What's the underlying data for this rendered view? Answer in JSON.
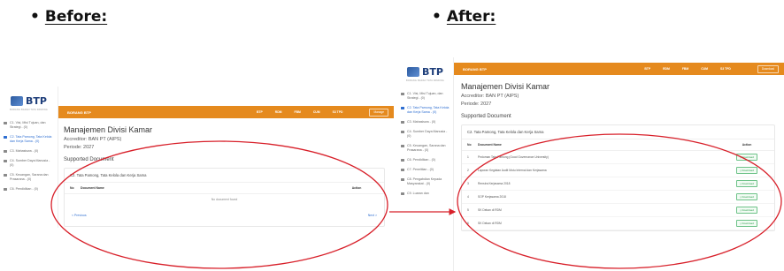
{
  "headings": {
    "bullet": "•",
    "before": "Before:",
    "after": "After:"
  },
  "app": {
    "logo": "BTP",
    "logo_sub": "BORANG BADAN TATA PAMONG",
    "topbar_title": "BORANG BTP",
    "topbar_menu": [
      "BTP",
      "RDM",
      "FBM",
      "CUM",
      "S3 TPD"
    ],
    "topbar_button": "Manage",
    "after_topbar_button": "Download"
  },
  "before": {
    "sidebar": [
      {
        "label": "C1. Visi, Misi Tujuan, dan Strategi - (0)",
        "active": false
      },
      {
        "label": "C2. Tata Pamong, Tata Kelola dan Kerja Sama - (0)",
        "active": true
      },
      {
        "label": "C3. Mahasiswa - (0)",
        "active": false
      },
      {
        "label": "C4. Sumber Daya Manusia - (0)",
        "active": false
      },
      {
        "label": "C5. Keuangan, Sarana dan Prasarana - (0)",
        "active": false
      },
      {
        "label": "C6. Pendidikan - (0)",
        "active": false
      }
    ],
    "page_title": "Manajemen Divisi Kamar",
    "accreditor": "Accreditor: BAN PT (AIPS)",
    "period": "Periode: 2027",
    "section_title": "Supported Document",
    "card_title": "C2. Tata Pamong, Tata Kelola dan Kerja Sama",
    "columns": {
      "no": "No",
      "name": "Document Name",
      "action": "Action"
    },
    "empty_text": "No document found",
    "prev": "< Previous",
    "next": "Next >"
  },
  "after": {
    "sidebar": [
      {
        "label": "C1. Visi, Misi Tujuan, dan Strategi - (0)",
        "active": false
      },
      {
        "label": "C2. Tata Pamong, Tata Kelola dan Kerja Sama - (0)",
        "active": true
      },
      {
        "label": "C3. Mahasiswa - (0)",
        "active": false
      },
      {
        "label": "C4. Sumber Daya Manusia - (0)",
        "active": false
      },
      {
        "label": "C5. Keuangan, Sarana dan Prasarana - (0)",
        "active": false
      },
      {
        "label": "C6. Pendidikan - (0)",
        "active": false
      },
      {
        "label": "C7. Penelitian - (0)",
        "active": false
      },
      {
        "label": "C8. Pengabdian Kepada Masyarakat - (0)",
        "active": false
      },
      {
        "label": "C9. Luaran dan",
        "active": false
      }
    ],
    "page_title": "Manajemen Divisi Kamar",
    "accreditor": "Accreditor: BAN PT (AIPS)",
    "period": "Periode: 2027",
    "section_title": "Supported Document",
    "card_title": "C2. Tata Pamong, Tata Kelola dan Kerja Sama",
    "columns": {
      "no": "No",
      "name": "Document Name",
      "action": "Action"
    },
    "download_label": "Download",
    "rows": [
      {
        "no": "1",
        "name": "Pedoman Tata Pamong (Good Governance University)"
      },
      {
        "no": "2",
        "name": "Laporan Kegiatan Audit Mutu Internal dan Kerjasama"
      },
      {
        "no": "3",
        "name": "Renstra Kerjasama 2018"
      },
      {
        "no": "4",
        "name": "SOP Kerjasama 2018"
      },
      {
        "no": "5",
        "name": "SK Dekan di RDM"
      },
      {
        "no": "6",
        "name": "SK Dekan di RDM"
      }
    ]
  },
  "colors": {
    "topbar": "#e58a1e",
    "annotation": "#d8202a",
    "link": "#2e6ed1",
    "download": "#2a9d4a"
  }
}
